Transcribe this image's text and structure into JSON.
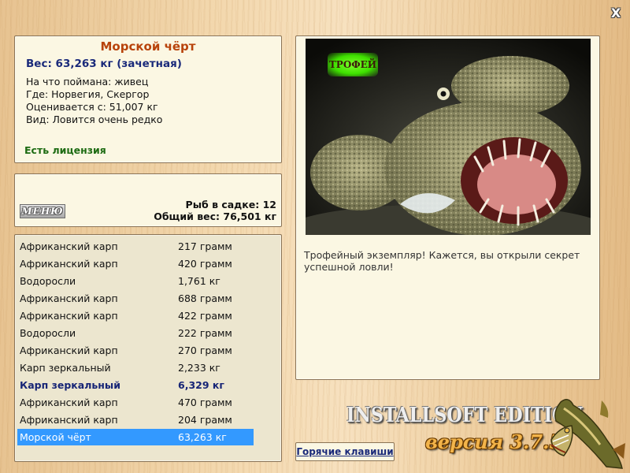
{
  "window": {
    "close_label": "X"
  },
  "info": {
    "fish_name": "Морской чёрт",
    "weight_line": "Вес: 63,263 кг (зачетная)",
    "details": [
      "На что поймана: живец",
      "Где: Норвегия, Скергор",
      "Оценивается с: 51,007 кг",
      "Вид: Ловится очень редко"
    ],
    "license": "Есть лицензия"
  },
  "summary": {
    "menu_label": "МЕНЮ",
    "fish_in_cage": "Рыб в садке: 12",
    "total_weight": "Общий вес: 76,501 кг"
  },
  "catch_list": [
    {
      "name": "Африканский карп",
      "weight": "217 грамм",
      "style": "normal"
    },
    {
      "name": "Африканский карп",
      "weight": "420 грамм",
      "style": "normal"
    },
    {
      "name": "Водоросли",
      "weight": "1,761 кг",
      "style": "normal"
    },
    {
      "name": "Африканский карп",
      "weight": "688 грамм",
      "style": "normal"
    },
    {
      "name": "Африканский карп",
      "weight": "422 грамм",
      "style": "normal"
    },
    {
      "name": "Водоросли",
      "weight": "222 грамм",
      "style": "normal"
    },
    {
      "name": "Африканский карп",
      "weight": "270 грамм",
      "style": "normal"
    },
    {
      "name": "Карп зеркальный",
      "weight": "2,233 кг",
      "style": "normal"
    },
    {
      "name": "Карп зеркальный",
      "weight": "6,329 кг",
      "style": "bold"
    },
    {
      "name": "Африканский карп",
      "weight": "470 грамм",
      "style": "normal"
    },
    {
      "name": "Африканский карп",
      "weight": "204 грамм",
      "style": "normal"
    },
    {
      "name": "Морской чёрт",
      "weight": "63,263 кг",
      "style": "selected"
    }
  ],
  "photo": {
    "badge": "ТРОФЕЙ",
    "caption": "Трофейный экземпляр! Кажется, вы открыли секрет успешной ловли!"
  },
  "brand": {
    "title": "INSTALLSOFT EDITION",
    "version": "версия 3.7.5"
  },
  "hotkeys_label": "Горячие клавиши",
  "colors": {
    "title": "#b8430b",
    "weight": "#1a2a7a",
    "license": "#1d6b12",
    "selection": "#3399ff"
  }
}
